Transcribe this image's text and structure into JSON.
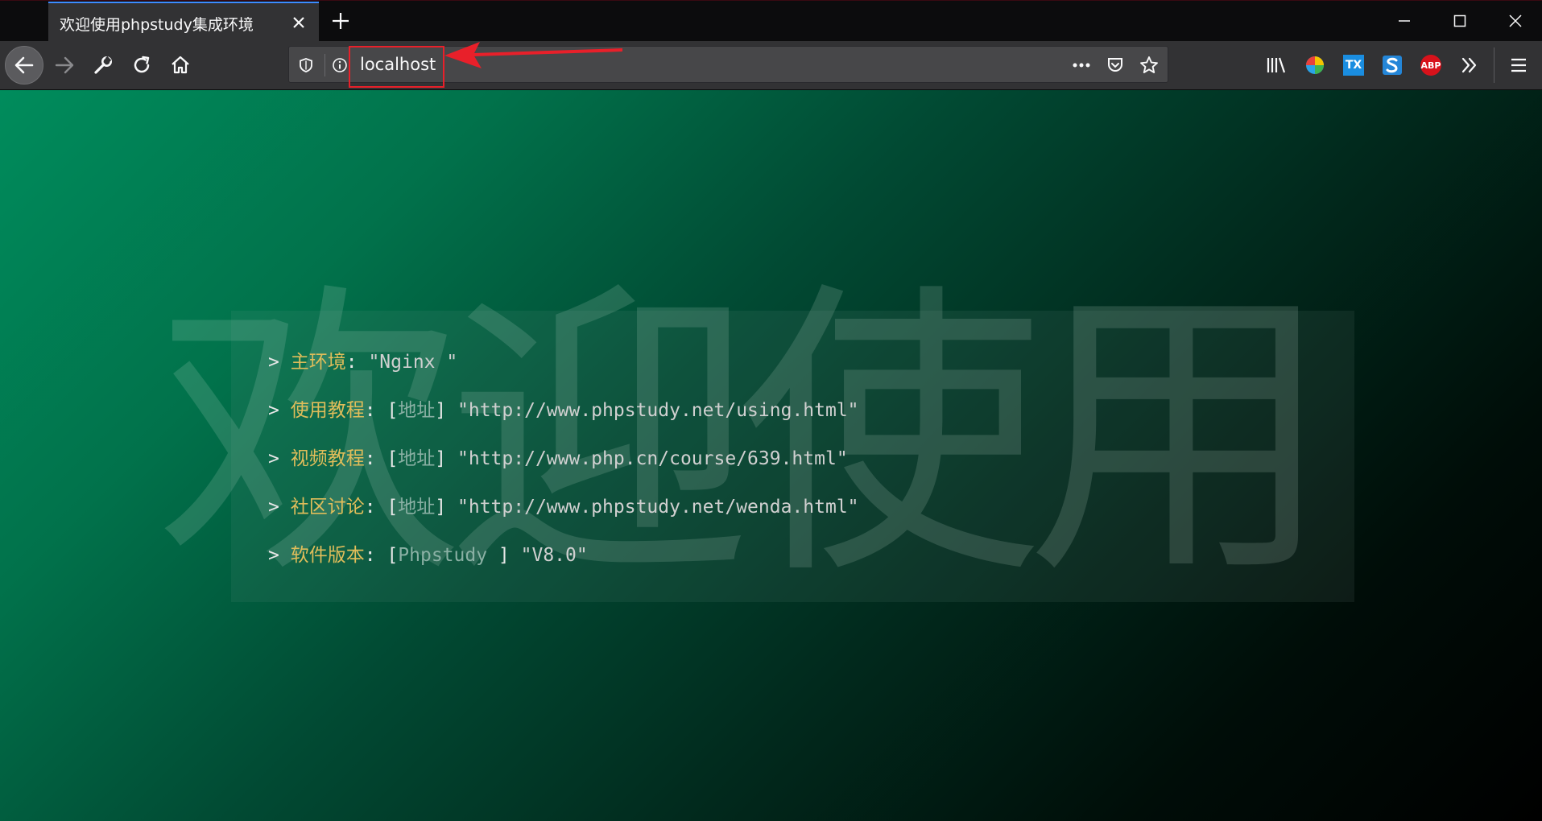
{
  "browser": {
    "tab": {
      "title": "欢迎使用phpstudy集成环境"
    },
    "address": {
      "url": "localhost"
    },
    "extensions": {
      "tx_label": "TX",
      "abp_label": "ABP"
    }
  },
  "page": {
    "background_text": "欢迎使用",
    "prompt": ">",
    "colon": ":",
    "items": [
      {
        "key": "主环境",
        "tag": "",
        "value": "\"Nginx \""
      },
      {
        "key": "使用教程",
        "tag": "地址",
        "value": "\"http://www.phpstudy.net/using.html\""
      },
      {
        "key": "视频教程",
        "tag": "地址",
        "value": "\"http://www.php.cn/course/639.html\""
      },
      {
        "key": "社区讨论",
        "tag": "地址",
        "value": "\"http://www.phpstudy.net/wenda.html\""
      },
      {
        "key": "软件版本",
        "tag": "Phpstudy ",
        "value": "\"V8.0\""
      }
    ]
  },
  "colors": {
    "accent": "#3d8bff",
    "highlight_box": "#e8202a",
    "key_text": "#e0bd5a",
    "tag_text": "#8ab0a4",
    "gradient_start": "#008c5c",
    "gradient_end": "#000000"
  }
}
